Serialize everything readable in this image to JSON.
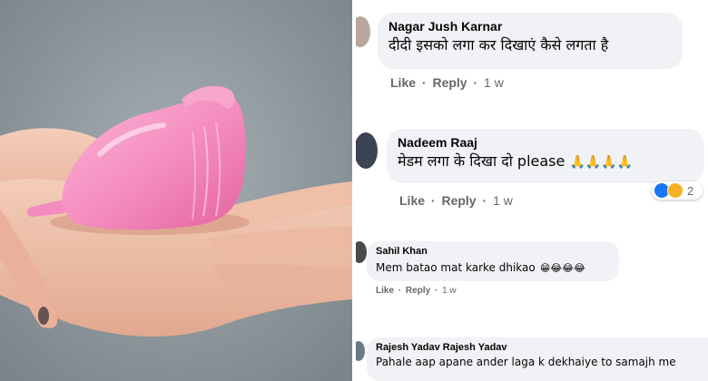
{
  "comments": [
    {
      "name": "Nagar Jush Karnar",
      "text": "दीदी इसको लगा कर दिखाएं कैसे लगता है",
      "like": "Like",
      "reply": "Reply",
      "time": "1 w"
    },
    {
      "name": "Nadeem Raaj",
      "text": "मेडम लगा के दिखा दो please",
      "emoji": "🙏🙏🙏🙏",
      "like": "Like",
      "reply": "Reply",
      "time": "1 w",
      "reaction_count": "2",
      "reaction_colors": [
        "#1877f2",
        "#f7b125"
      ]
    },
    {
      "name": "Sahil Khan",
      "text": "Mem batao mat karke dhikao",
      "emoji": "😁😂😂😂",
      "like": "Like",
      "reply": "Reply",
      "time": "1 w"
    },
    {
      "name": "Rajesh Yadav Rajesh Yadav",
      "text": "Pahale aap apane ander laga k dekhaiye to samajh me"
    }
  ],
  "separator": "·",
  "colors": {
    "bubble": "#f0f2f5",
    "meta_text": "#65676b",
    "cup_pink": "#f58fc0"
  }
}
